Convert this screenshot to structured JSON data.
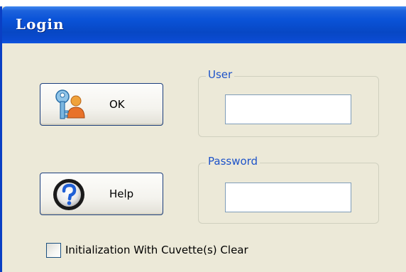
{
  "window": {
    "title": "Login"
  },
  "buttons": {
    "ok": {
      "label": "OK",
      "icon": "key-user-icon"
    },
    "help": {
      "label": "Help",
      "icon": "help-question-icon"
    }
  },
  "fields": {
    "user": {
      "legend": "User",
      "value": "",
      "placeholder": ""
    },
    "password": {
      "legend": "Password",
      "value": "",
      "placeholder": ""
    }
  },
  "options": {
    "init_clear": {
      "label": "Initialization With Cuvette(s) Clear",
      "checked": false
    }
  },
  "colors": {
    "titlebar": "#0a53d8",
    "dialog_bg": "#ece9d8",
    "legend_text": "#1d53c9"
  }
}
